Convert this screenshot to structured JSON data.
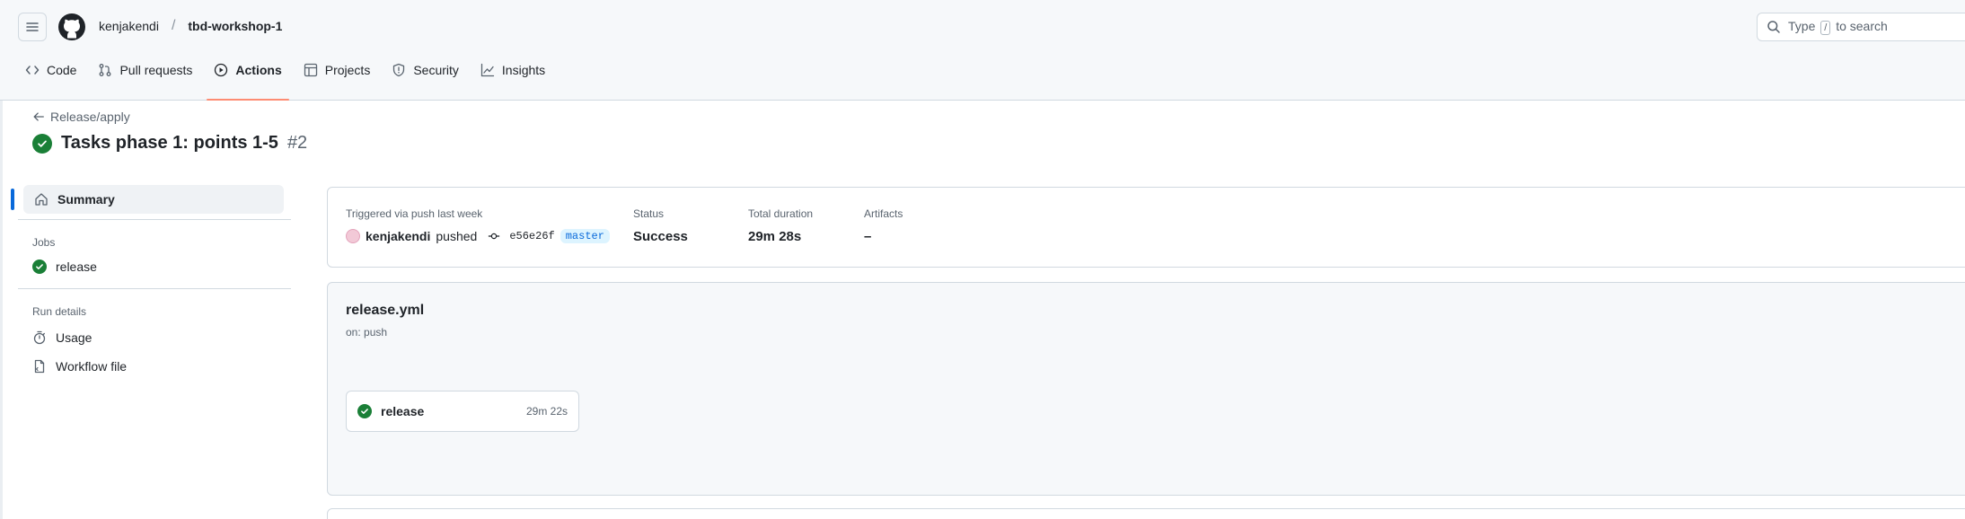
{
  "header": {
    "owner": "kenjakendi",
    "separator": "/",
    "repo": "tbd-workshop-1",
    "search": {
      "prefix": "Type",
      "key": "/",
      "suffix": "to search"
    }
  },
  "tabs": [
    {
      "label": "Code",
      "icon": "code-icon"
    },
    {
      "label": "Pull requests",
      "icon": "git-pull-request-icon"
    },
    {
      "label": "Actions",
      "icon": "play-icon",
      "active": true
    },
    {
      "label": "Projects",
      "icon": "table-icon"
    },
    {
      "label": "Security",
      "icon": "shield-icon"
    },
    {
      "label": "Insights",
      "icon": "graph-icon"
    }
  ],
  "run": {
    "back_label": "Release/apply",
    "title": "Tasks phase 1: points 1-5",
    "number": "#2",
    "status_icon": "check-circle-icon"
  },
  "sidebar": {
    "summary_label": "Summary",
    "jobs_heading": "Jobs",
    "jobs": [
      {
        "label": "release",
        "icon": "check-circle-icon"
      }
    ],
    "run_details_heading": "Run details",
    "details": [
      {
        "label": "Usage",
        "icon": "stopwatch-icon"
      },
      {
        "label": "Workflow file",
        "icon": "file-icon"
      }
    ]
  },
  "summary": {
    "trigger_label": "Triggered via push last week",
    "actor": "kenjakendi",
    "action": "pushed",
    "commit": "e56e26f",
    "branch": "master",
    "status_label": "Status",
    "status_value": "Success",
    "duration_label": "Total duration",
    "duration_value": "29m 28s",
    "artifacts_label": "Artifacts",
    "artifacts_value": "–"
  },
  "workflow": {
    "file": "release.yml",
    "trigger": "on: push",
    "job": {
      "name": "release",
      "duration": "29m 22s"
    }
  },
  "colors": {
    "success": "#1a7f37",
    "accent": "#0969da",
    "active_tab_underline": "#fd8c73"
  }
}
